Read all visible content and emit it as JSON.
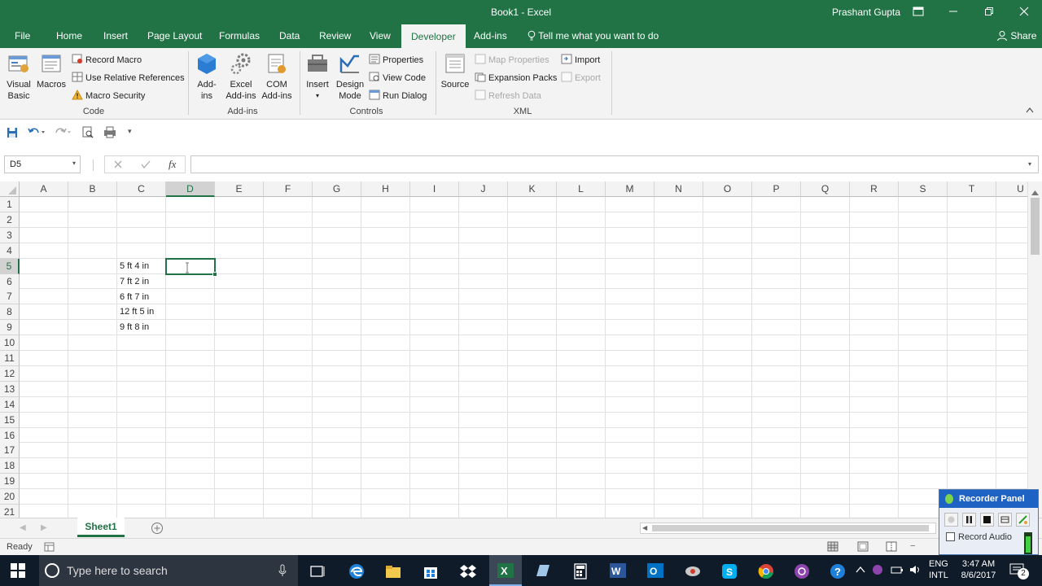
{
  "window": {
    "title": "Book1 - Excel",
    "user": "Prashant Gupta",
    "share": "Share"
  },
  "tabs": [
    "File",
    "Home",
    "Insert",
    "Page Layout",
    "Formulas",
    "Data",
    "Review",
    "View",
    "Developer",
    "Add-ins"
  ],
  "active_tab": "Developer",
  "tell_me": "Tell me what you want to do",
  "ribbon": {
    "code": {
      "label": "Code",
      "visual_basic": [
        "Visual",
        "Basic"
      ],
      "macros": "Macros",
      "record_macro": "Record Macro",
      "use_relative": "Use Relative References",
      "macro_security": "Macro Security"
    },
    "addins": {
      "label": "Add-ins",
      "addins_btn": [
        "Add-",
        "ins"
      ],
      "excel_addins": [
        "Excel",
        "Add-ins"
      ],
      "com_addins": [
        "COM",
        "Add-ins"
      ]
    },
    "controls": {
      "label": "Controls",
      "insert": "Insert",
      "design_mode": [
        "Design",
        "Mode"
      ],
      "properties": "Properties",
      "view_code": "View Code",
      "run_dialog": "Run Dialog"
    },
    "xml": {
      "label": "XML",
      "source": "Source",
      "map_properties": "Map Properties",
      "expansion_packs": "Expansion Packs",
      "refresh_data": "Refresh Data",
      "import": "Import",
      "export": "Export"
    }
  },
  "namebox": "D5",
  "fx": "fx",
  "columns": [
    "A",
    "B",
    "C",
    "D",
    "E",
    "F",
    "G",
    "H",
    "I",
    "J",
    "K",
    "L",
    "M",
    "N",
    "O",
    "P",
    "Q",
    "R",
    "S",
    "T",
    "U"
  ],
  "rows": [
    "1",
    "2",
    "3",
    "4",
    "5",
    "6",
    "7",
    "8",
    "9",
    "10",
    "11",
    "12",
    "13",
    "14",
    "15",
    "16",
    "17",
    "18",
    "19",
    "20",
    "21"
  ],
  "cells": {
    "C5": "5 ft 4 in",
    "C6": "7 ft 2 in",
    "C7": "6 ft 7 in",
    "C8": "12 ft 5 in",
    "C9": "9 ft 8 in"
  },
  "selected_cell": "D5",
  "sheet_tab": "Sheet1",
  "status": "Ready",
  "taskbar": {
    "search_placeholder": "Type here to search",
    "lang": [
      "ENG",
      "INTL"
    ],
    "time": "3:47 AM",
    "date": "8/6/2017",
    "notif_count": "2"
  },
  "recorder": {
    "title": "Recorder Panel",
    "record_audio": "Record Audio"
  },
  "colors": {
    "excel_green": "#217346",
    "taskbar": "#101b29"
  }
}
